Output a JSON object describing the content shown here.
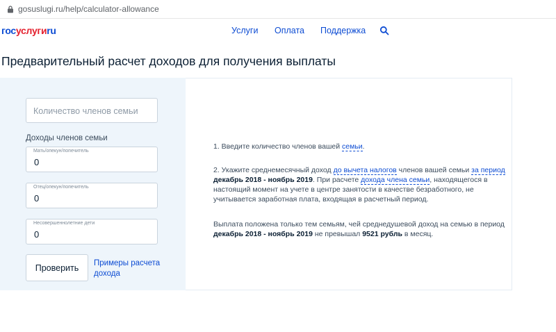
{
  "browser": {
    "url": "gosuslugi.ru/help/calculator-allowance"
  },
  "header": {
    "logo": {
      "gos": "гос",
      "uslugi": "услуги",
      "ru": "ru"
    },
    "nav": [
      "Услуги",
      "Оплата",
      "Поддержка"
    ]
  },
  "page": {
    "title": "Предварительный расчет доходов для получения выплаты"
  },
  "form": {
    "members_placeholder": "Количество членов семьи",
    "income_label": "Доходы членов семьи",
    "incomes": [
      {
        "caption": "Мать/опекун/попечитель",
        "value": "0"
      },
      {
        "caption": "Отец/опекун/попечитель",
        "value": "0"
      },
      {
        "caption": "Несовершеннолетние дети",
        "value": "0"
      }
    ],
    "submit_label": "Проверить",
    "examples_link": "Примеры расчета дохода"
  },
  "info": {
    "p1": {
      "text": "1. Введите количество членов вашей ",
      "link": "семьи",
      "end": "."
    },
    "p2": {
      "t1": "2. Укажите среднемесячный доход ",
      "link1": "до вычета налогов",
      "t2": " членов вашей семьи ",
      "link2": "за период",
      "br1": "декабрь 2018 - ноябрь 2019",
      "t3": ". При расчете ",
      "link3": "дохода члена семьи",
      "t4": ", находящегося в настоящий момент на учете в центре занятости в качестве безработного, не учитывается заработная плата, входящая в расчетный период."
    },
    "p3": {
      "t1": "Выплата положена только тем семьям, чей среднедушевой доход на семью в период ",
      "b1": "декабрь 2018 - ноябрь 2019",
      "t2": " не превышал ",
      "b2": "9521 рубль",
      "t3": " в месяц."
    }
  }
}
